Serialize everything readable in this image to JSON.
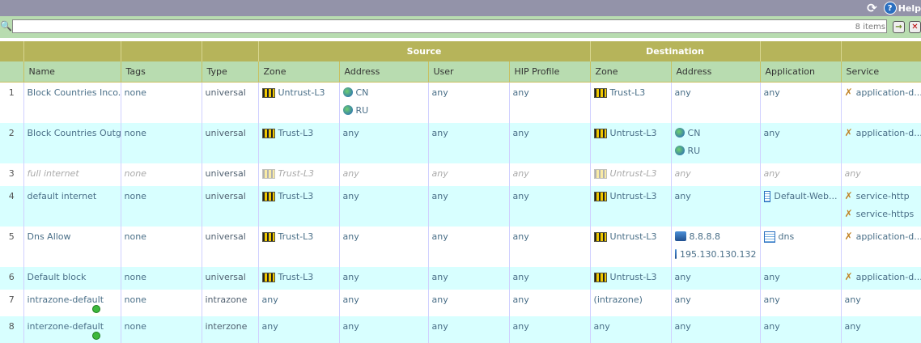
{
  "toolbar": {
    "help_label": "Help",
    "refresh_icon": "refresh-icon",
    "help_icon": "help-icon"
  },
  "filter": {
    "value": "",
    "count": "8 items",
    "apply_icon": "arrow-right-icon",
    "clear_icon": "close-icon"
  },
  "groups": {
    "source": "Source",
    "destination": "Destination"
  },
  "columns": [
    "Name",
    "Tags",
    "Type",
    "Zone",
    "Address",
    "User",
    "HIP Profile",
    "Zone",
    "Address",
    "Application",
    "Service"
  ],
  "rows": [
    {
      "num": "1",
      "name": "Block Countries Inco...",
      "tags": "none",
      "type": "universal",
      "src_zone": [
        "Untrust-L3"
      ],
      "src_addr": [
        "CN",
        "RU"
      ],
      "user": "any",
      "hip": "any",
      "dst_zone": [
        "Trust-L3"
      ],
      "dst_addr": [
        "any"
      ],
      "app": [
        "any"
      ],
      "service": [
        "application-d..."
      ]
    },
    {
      "num": "2",
      "name": "Block Countries Outg...",
      "tags": "none",
      "type": "universal",
      "src_zone": [
        "Trust-L3"
      ],
      "src_addr": [
        "any"
      ],
      "user": "any",
      "hip": "any",
      "dst_zone": [
        "Untrust-L3"
      ],
      "dst_addr": [
        "CN",
        "RU"
      ],
      "app": [
        "any"
      ],
      "service": [
        "application-d..."
      ]
    },
    {
      "num": "3",
      "name": "full internet",
      "tags": "none",
      "type": "universal",
      "src_zone": [
        "Trust-L3"
      ],
      "src_addr": [
        "any"
      ],
      "user": "any",
      "hip": "any",
      "dst_zone": [
        "Untrust-L3"
      ],
      "dst_addr": [
        "any"
      ],
      "app": [
        "any"
      ],
      "service": [
        "any"
      ],
      "disabled": true
    },
    {
      "num": "4",
      "name": "default internet",
      "tags": "none",
      "type": "universal",
      "src_zone": [
        "Trust-L3"
      ],
      "src_addr": [
        "any"
      ],
      "user": "any",
      "hip": "any",
      "dst_zone": [
        "Untrust-L3"
      ],
      "dst_addr": [
        "any"
      ],
      "app": [
        "Default-Web..."
      ],
      "service": [
        "service-http",
        "service-https"
      ]
    },
    {
      "num": "5",
      "name": "Dns Allow",
      "tags": "none",
      "type": "universal",
      "src_zone": [
        "Trust-L3"
      ],
      "src_addr": [
        "any"
      ],
      "user": "any",
      "hip": "any",
      "dst_zone": [
        "Untrust-L3"
      ],
      "dst_addr": [
        "8.8.8.8",
        "195.130.130.132"
      ],
      "app": [
        "dns"
      ],
      "service": [
        "application-d..."
      ]
    },
    {
      "num": "6",
      "name": "Default block",
      "tags": "none",
      "type": "universal",
      "src_zone": [
        "Trust-L3"
      ],
      "src_addr": [
        "any"
      ],
      "user": "any",
      "hip": "any",
      "dst_zone": [
        "Untrust-L3"
      ],
      "dst_addr": [
        "any"
      ],
      "app": [
        "any"
      ],
      "service": [
        "application-d..."
      ]
    },
    {
      "num": "7",
      "name": "intrazone-default",
      "tags": "none",
      "type": "intrazone",
      "src_zone": [
        "any"
      ],
      "src_addr": [
        "any"
      ],
      "user": "any",
      "hip": "any",
      "dst_zone": [
        "(intrazone)"
      ],
      "dst_addr": [
        "any"
      ],
      "app": [
        "any"
      ],
      "service": [
        "any"
      ],
      "default": true
    },
    {
      "num": "8",
      "name": "interzone-default",
      "tags": "none",
      "type": "interzone",
      "src_zone": [
        "any"
      ],
      "src_addr": [
        "any"
      ],
      "user": "any",
      "hip": "any",
      "dst_zone": [
        "any"
      ],
      "dst_addr": [
        "any"
      ],
      "app": [
        "any"
      ],
      "service": [
        "any"
      ],
      "default": true
    }
  ]
}
